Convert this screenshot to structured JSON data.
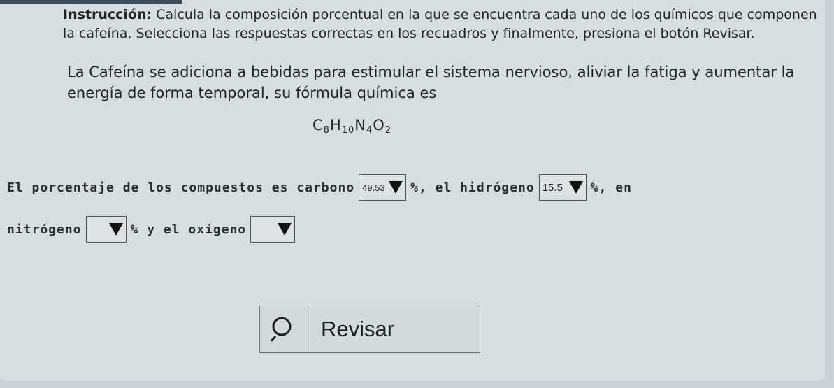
{
  "instruction": {
    "lead": "Instrucción:",
    "text": " Calcula la composición porcentual en la que se encuentra cada uno de los químicos que componen la cafeína, Selecciona las respuestas correctas en los recuadros y finalmente, presiona el botón Revisar."
  },
  "intro": "La Cafeína se adiciona a bebidas para estimular el sistema nervioso, aliviar la fatiga y aumentar la energía de forma temporal, su fórmula química es",
  "formula": {
    "c": "C",
    "c_sub": "8",
    "h": "H",
    "h_sub": "10",
    "n": "N",
    "n_sub": "4",
    "o": "O",
    "o_sub": "2"
  },
  "question": {
    "part1": "El porcentaje de los compuestos es carbono",
    "part2": "%, el hidrógeno",
    "part3": "%, en",
    "part4": "nitrógeno",
    "part5": "% y el oxígeno"
  },
  "selects": {
    "carbon": "49.53",
    "hydrogen": "15.5",
    "nitrogen": "",
    "oxygen": ""
  },
  "button": {
    "icon": "search-icon",
    "label": "Revisar"
  }
}
